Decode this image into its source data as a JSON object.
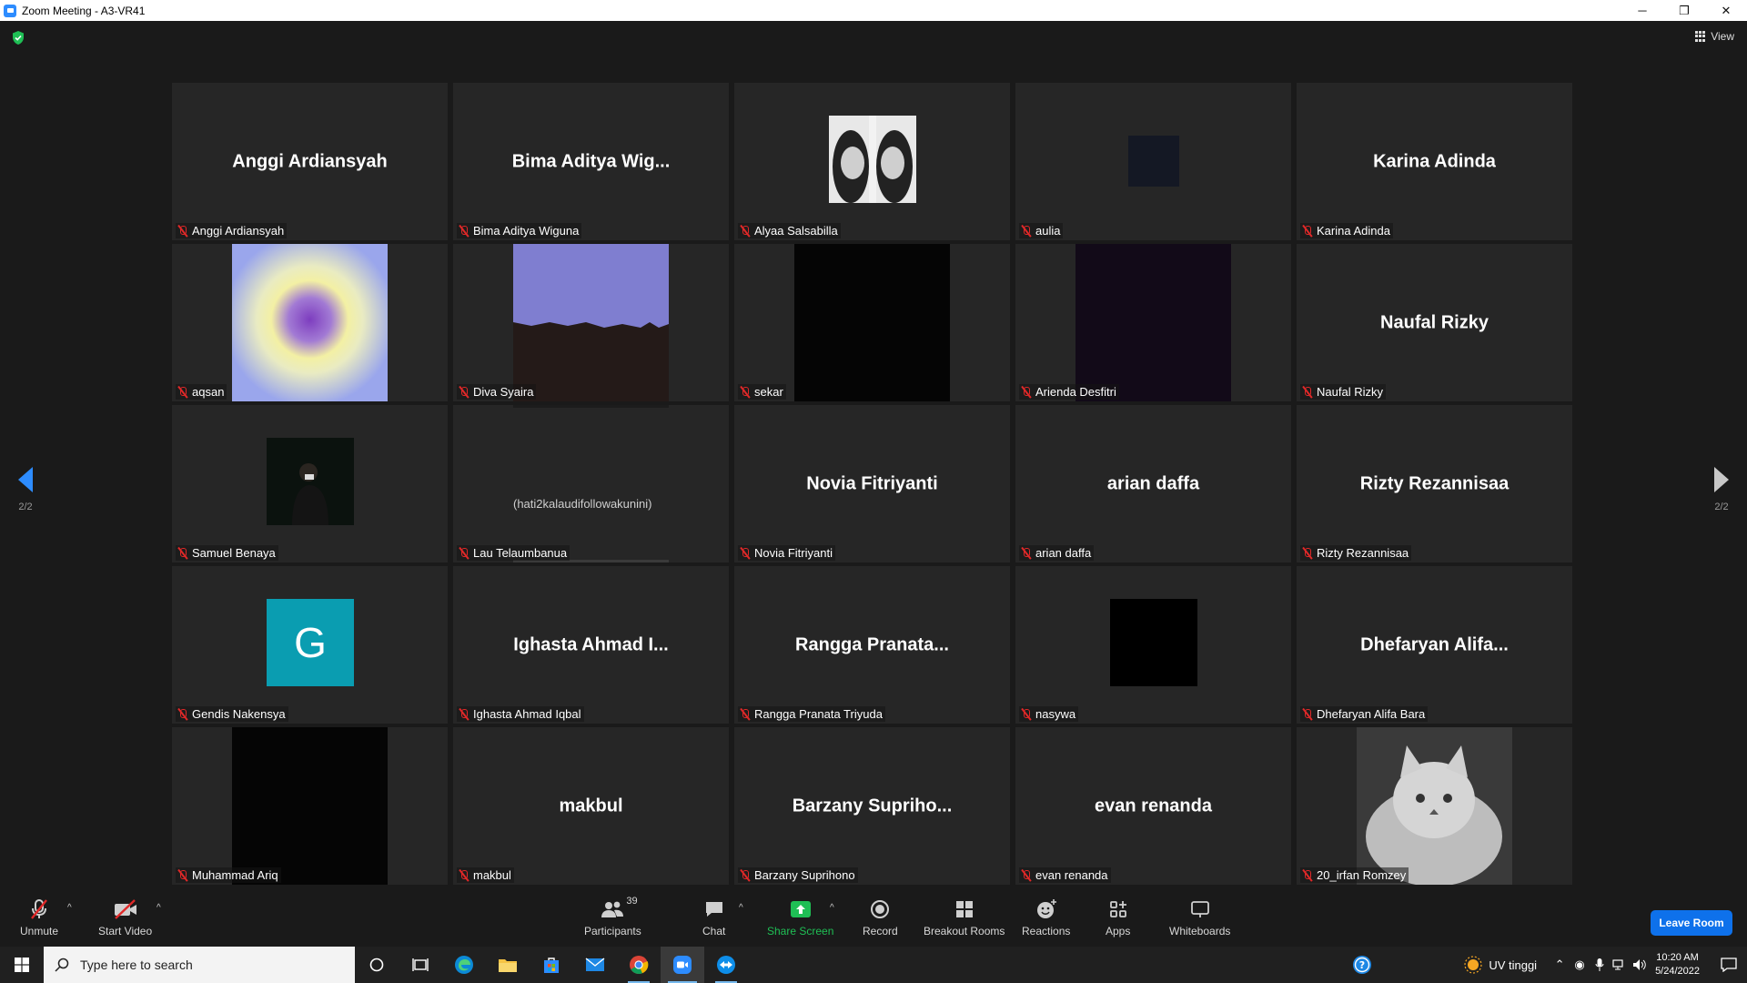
{
  "window": {
    "title": "Zoom Meeting - A3-VR41",
    "minimize": "─",
    "restore": "❐",
    "close": "✕"
  },
  "meeting": {
    "view_label": "View",
    "page_left": "2/2",
    "page_right": "2/2",
    "tiles": [
      {
        "big": "Anggi Ardiansyah",
        "label": "Anggi Ardiansyah"
      },
      {
        "big": "Bima Aditya Wig...",
        "label": "Bima Aditya Wiguna"
      },
      {
        "big": "",
        "label": "Alyaa Salsabilla",
        "media": "photo"
      },
      {
        "big": "",
        "label": "aulia",
        "media": "dark-square"
      },
      {
        "big": "Karina Adinda",
        "label": "Karina Adinda"
      },
      {
        "big": "",
        "label": "aqsan",
        "media": "heart-gradient"
      },
      {
        "big": "",
        "label": "Diva Syaira",
        "media": "paper"
      },
      {
        "big": "",
        "label": "sekar",
        "media": "black"
      },
      {
        "big": "",
        "label": "Arienda Desfitri",
        "media": "dark-purple"
      },
      {
        "big": "Naufal Rizky",
        "label": "Naufal Rizky"
      },
      {
        "big": "",
        "label": "Samuel Benaya",
        "media": "night-photo"
      },
      {
        "big": "",
        "label": "Lau Telaumbanua",
        "media": "text-image",
        "media_text": "(hati2kalaudifollowakunini)"
      },
      {
        "big": "Novia Fitriyanti",
        "label": "Novia Fitriyanti"
      },
      {
        "big": "arian daffa",
        "label": "arian daffa"
      },
      {
        "big": "Rizty Rezannisaa",
        "label": "Rizty Rezannisaa"
      },
      {
        "big": "",
        "label": "Gendis Nakensya",
        "media": "avatar-letter",
        "avatar_letter": "G"
      },
      {
        "big": "Ighasta Ahmad I...",
        "label": "Ighasta Ahmad Iqbal"
      },
      {
        "big": "Rangga Pranata...",
        "label": "Rangga Pranata Triyuda"
      },
      {
        "big": "",
        "label": "nasywa",
        "media": "black-small"
      },
      {
        "big": "Dhefaryan Alifa...",
        "label": "Dhefaryan Alifa Bara"
      },
      {
        "big": "",
        "label": "Muhammad Ariq",
        "media": "black"
      },
      {
        "big": "makbul",
        "label": "makbul"
      },
      {
        "big": "Barzany Supriho...",
        "label": "Barzany Suprihono"
      },
      {
        "big": "evan renanda",
        "label": "evan renanda"
      },
      {
        "big": "",
        "label": "20_irfan Romzey",
        "media": "cat-photo"
      }
    ]
  },
  "toolbar": {
    "unmute": "Unmute",
    "start_video": "Start Video",
    "participants": "Participants",
    "participants_count": "39",
    "chat": "Chat",
    "share_screen": "Share Screen",
    "record": "Record",
    "breakout_rooms": "Breakout Rooms",
    "reactions": "Reactions",
    "apps": "Apps",
    "whiteboards": "Whiteboards",
    "leave_room": "Leave Room"
  },
  "taskbar": {
    "search_placeholder": "Type here to search",
    "weather": "UV tinggi",
    "time": "10:20 AM",
    "date": "5/24/2022"
  },
  "colors": {
    "accent": "#2d8cff",
    "leave": "#0e71eb",
    "share_green": "#1fbf55",
    "muted_red": "#e02828",
    "avatar_teal": "#0a9db1"
  }
}
